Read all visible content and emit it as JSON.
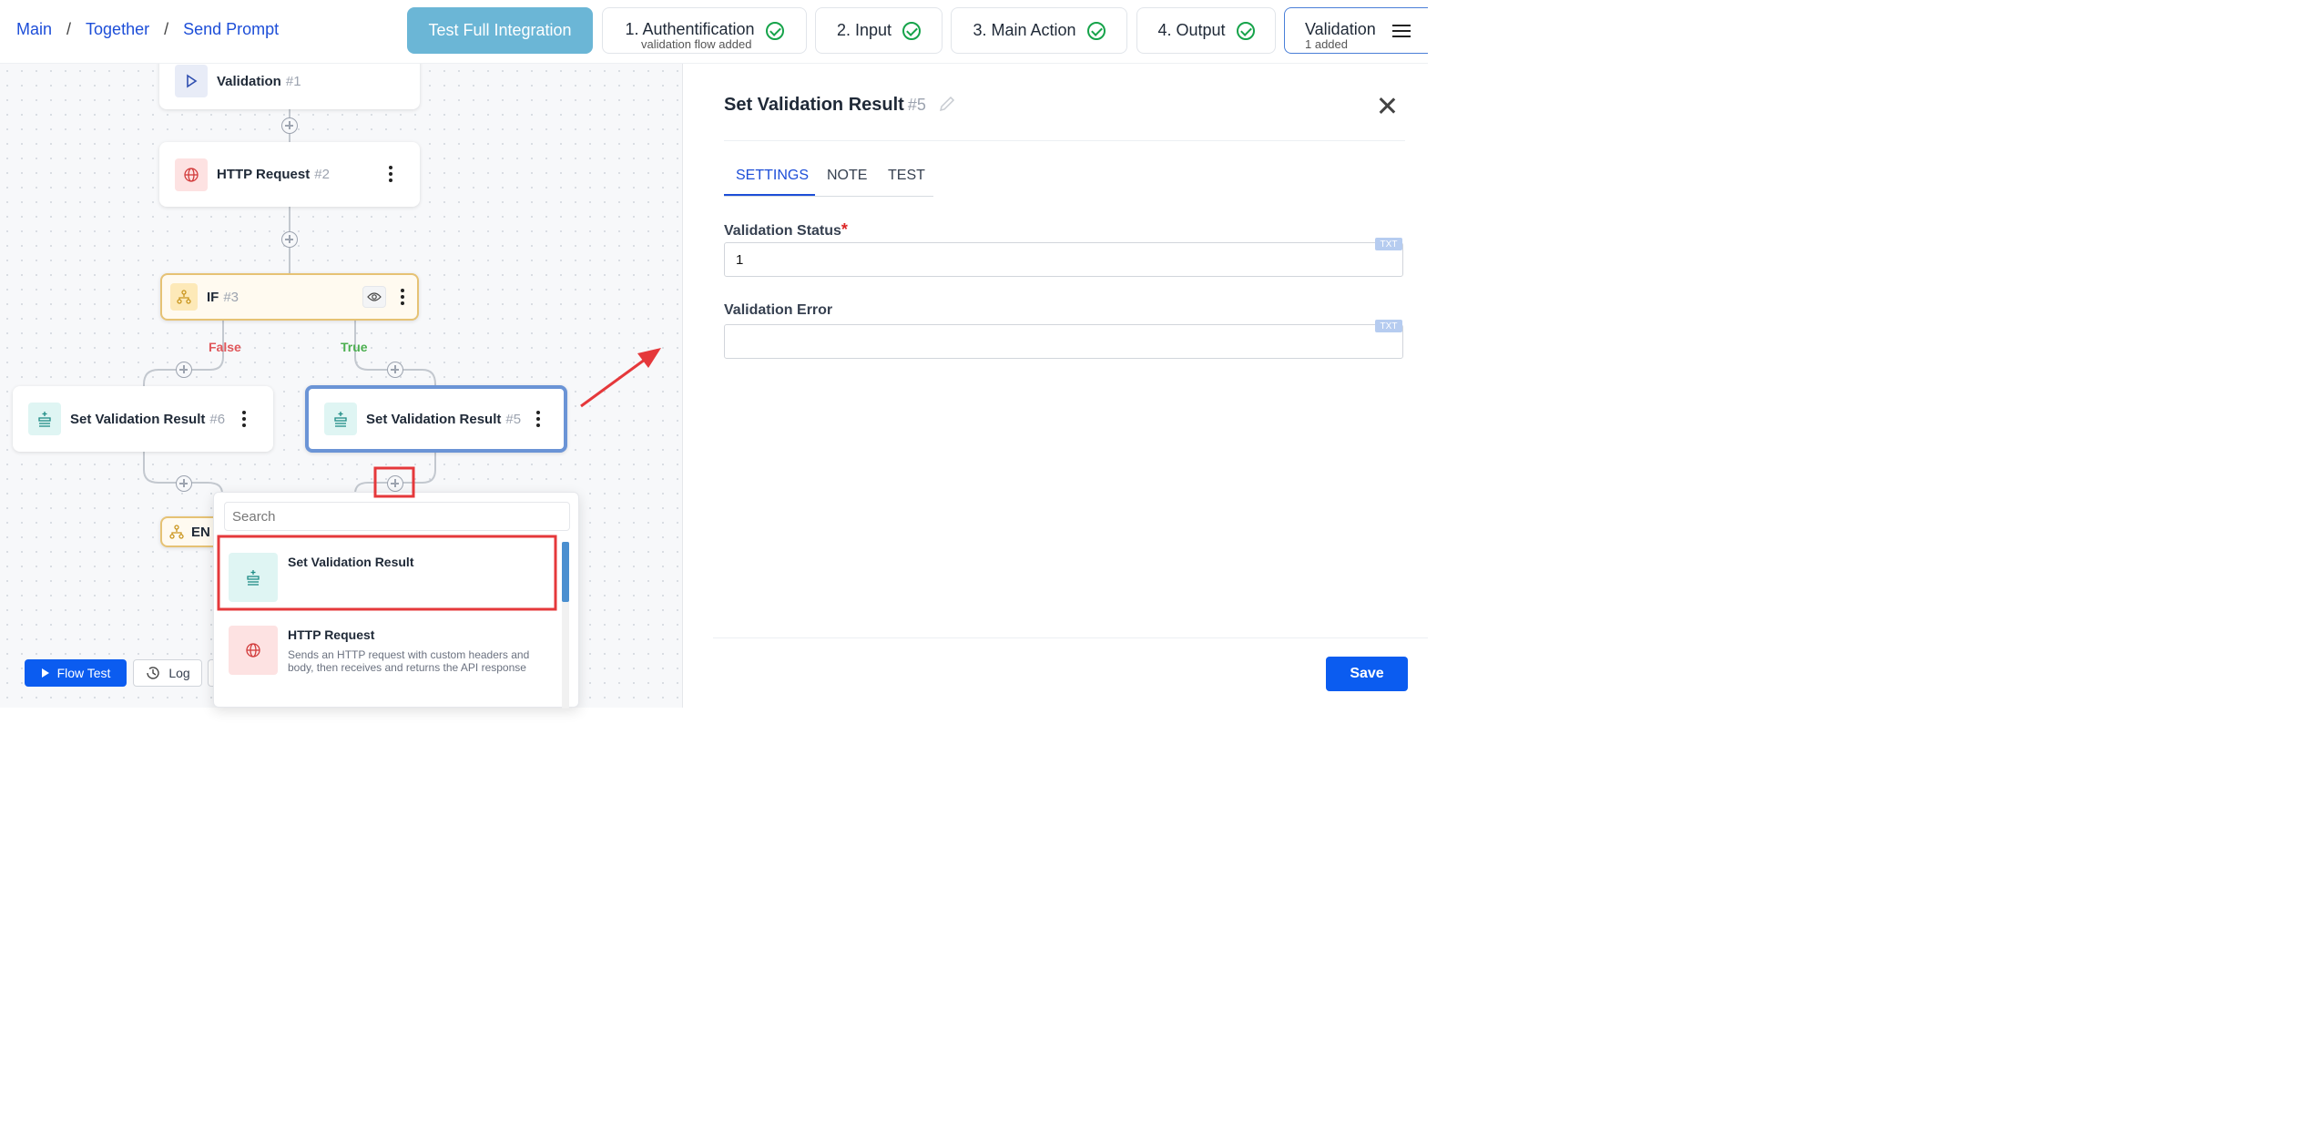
{
  "breadcrumb": {
    "items": [
      "Main",
      "Together",
      "Send Prompt"
    ],
    "separator": "/"
  },
  "header": {
    "test_full_label": "Test Full Integration",
    "steps": [
      {
        "label": "1. Authentification",
        "sub": "validation flow added",
        "status": "check"
      },
      {
        "label": "2. Input",
        "status": "check"
      },
      {
        "label": "3. Main Action",
        "status": "check"
      },
      {
        "label": "4. Output",
        "status": "check"
      },
      {
        "label": "Validation",
        "sub": "1 added"
      }
    ]
  },
  "canvas": {
    "nodes": [
      {
        "title": "Validation",
        "num": "#1",
        "icon": "play-icon"
      },
      {
        "title": "HTTP Request",
        "num": "#2",
        "icon": "globe-icon"
      },
      {
        "title": "IF",
        "num": "#3",
        "icon": "branch-icon"
      },
      {
        "title": "Set Validation Result",
        "num": "#6",
        "icon": "set-result-icon"
      },
      {
        "title": "Set Validation Result",
        "num": "#5",
        "icon": "set-result-icon"
      },
      {
        "title": "EN",
        "icon": "branch-icon"
      }
    ],
    "branch_false": "False",
    "branch_true": "True",
    "flow_test_label": "Flow Test",
    "log_label": "Log"
  },
  "popup": {
    "search_placeholder": "Search",
    "items": [
      {
        "title": "Set Validation Result",
        "desc": "",
        "icon": "set-result-icon"
      },
      {
        "title": "HTTP Request",
        "desc": "Sends an HTTP request with custom headers and body, then receives and returns the API response",
        "icon": "globe-icon"
      }
    ]
  },
  "panel": {
    "title": "Set Validation Result",
    "num": "#5",
    "tabs": [
      "SETTINGS",
      "NOTE",
      "TEST"
    ],
    "active_tab": "SETTINGS",
    "fields": [
      {
        "label": "Validation Status",
        "required": "*",
        "value": "1",
        "badge": "TXT"
      },
      {
        "label": "Validation Error",
        "value": "",
        "badge": "TXT"
      }
    ],
    "save_label": "Save"
  },
  "colors": {
    "accent": "#0b5cf0",
    "selected_node": "#6b94d6",
    "highlight": "#e5383b",
    "if_node_border": "#e6c274",
    "false_label": "#e0575b",
    "true_label": "#4caf50"
  }
}
